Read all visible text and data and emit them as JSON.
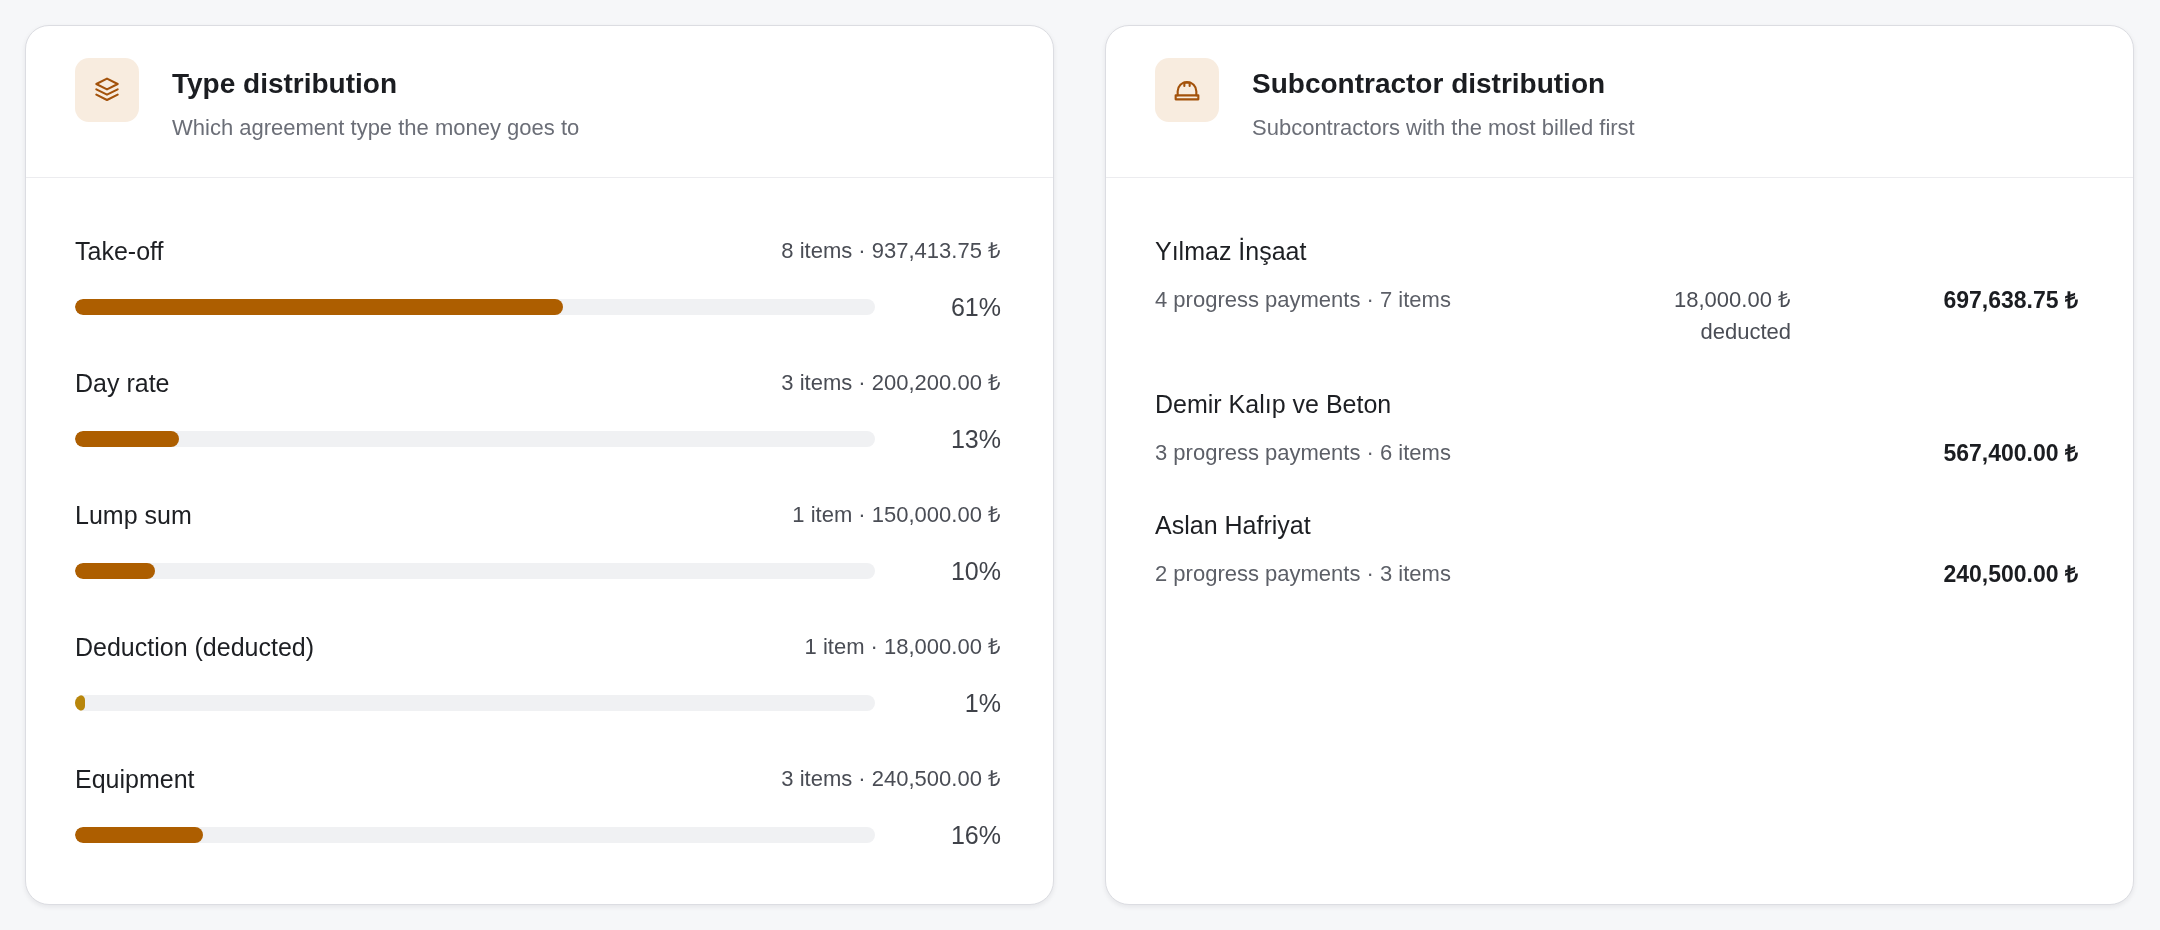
{
  "type_distribution": {
    "title": "Type distribution",
    "subtitle": "Which agreement type the money goes to",
    "items": [
      {
        "label": "Take-off",
        "summary": "8 items · 937,413.75 ₺",
        "level": 0.61,
        "percent": "61%",
        "color": "#ad5e00"
      },
      {
        "label": "Day rate",
        "summary": "3 items · 200,200.00 ₺",
        "level": 0.13,
        "percent": "13%",
        "color": "#ad5e00"
      },
      {
        "label": "Lump sum",
        "summary": "1 item · 150,000.00 ₺",
        "level": 0.1,
        "percent": "10%",
        "color": "#ad5e00"
      },
      {
        "label": "Deduction (deducted)",
        "summary": "1 item · 18,000.00 ₺",
        "level": 0.01,
        "percent": "1%",
        "color": "#b8860b"
      },
      {
        "label": "Equipment",
        "summary": "3 items · 240,500.00 ₺",
        "level": 0.16,
        "percent": "16%",
        "color": "#ad5e00"
      }
    ]
  },
  "subcontractor_distribution": {
    "title": "Subcontractor distribution",
    "subtitle": "Subcontractors with the most billed first",
    "items": [
      {
        "name": "Yılmaz İnşaat",
        "summary": "4 progress payments · 7 items",
        "deduction": "18,000.00 ₺ deducted",
        "amount": "697,638.75 ₺"
      },
      {
        "name": "Demir Kalıp ve Beton",
        "summary": "3 progress payments · 6 items",
        "amount": "567,400.00 ₺"
      },
      {
        "name": "Aslan Hafriyat",
        "summary": "2 progress payments · 3 items",
        "amount": "240,500.00 ₺"
      }
    ]
  }
}
